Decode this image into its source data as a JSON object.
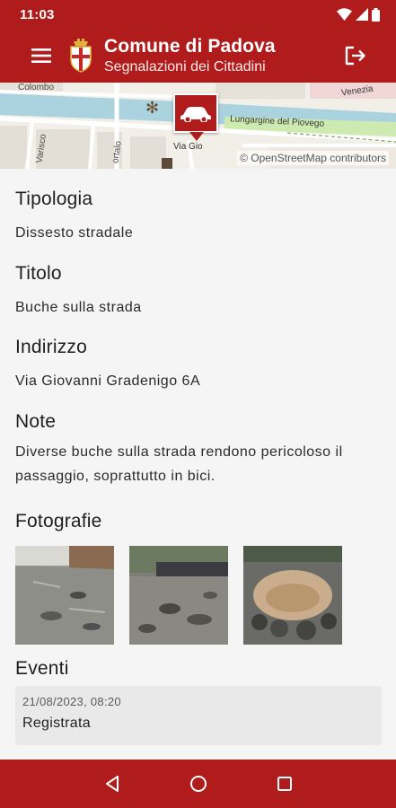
{
  "status_bar": {
    "time": "11:03"
  },
  "app_bar": {
    "title": "Comune di Padova",
    "subtitle": "Segnalazioni dei Cittadini"
  },
  "map": {
    "attribution": "© OpenStreetMap contributors",
    "street_labels": [
      "Colombo",
      "Lungargine del Piovego",
      "Venezia",
      "Varisco",
      "ortalo",
      "Via Gio"
    ]
  },
  "report": {
    "sections": [
      {
        "title": "Tipologia",
        "value": "Dissesto stradale"
      },
      {
        "title": "Titolo",
        "value": "Buche sulla strada"
      },
      {
        "title": "Indirizzo",
        "value": "Via Giovanni Gradenigo 6A"
      },
      {
        "title": "Note",
        "value": "Diverse buche sulla strada rendono pericoloso il passaggio, soprattutto in bici."
      }
    ],
    "photos_title": "Fotografie",
    "photos": [
      "photo-1",
      "photo-2",
      "photo-3"
    ],
    "events_title": "Eventi",
    "events": [
      {
        "date": "21/08/2023, 08:20",
        "status": "Registrata"
      }
    ]
  },
  "colors": {
    "primary": "#b01c1c",
    "background": "#f5f5f5",
    "card": "#e9e9e9"
  },
  "icons": {
    "menu": "menu-icon",
    "logout": "logout-icon",
    "marker": "car-icon",
    "nav": [
      "back-icon",
      "home-icon",
      "recents-icon"
    ]
  }
}
